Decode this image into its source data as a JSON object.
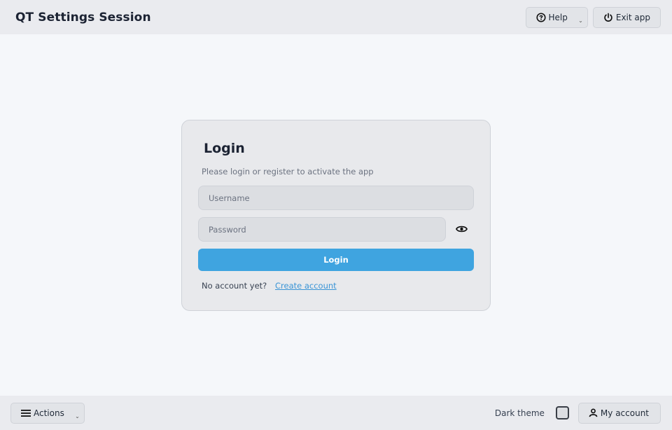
{
  "app": {
    "title": "QT Settings Session"
  },
  "header": {
    "help_label": "Help",
    "help_caret": "⌄",
    "exit_label": "Exit app"
  },
  "login": {
    "title": "Login",
    "subtitle": "Please login or register to activate the app",
    "username_placeholder": "Username",
    "username_value": "",
    "password_placeholder": "Password",
    "password_value": "",
    "submit_label": "Login",
    "no_account_text": "No account yet?",
    "create_account_label": "Create account"
  },
  "footer": {
    "actions_label": "Actions",
    "actions_caret": "⌄",
    "dark_theme_label": "Dark theme",
    "dark_theme_checked": false,
    "my_account_label": "My account"
  },
  "icons": {
    "help": "help-circle-icon",
    "exit": "power-icon",
    "eye": "eye-icon",
    "menu": "hamburger-menu-icon",
    "user": "user-icon"
  },
  "colors": {
    "primary": "#3fa4e0",
    "link": "#3b95d6",
    "bar_bg": "#eaebef",
    "page_bg": "#f5f7fa"
  }
}
